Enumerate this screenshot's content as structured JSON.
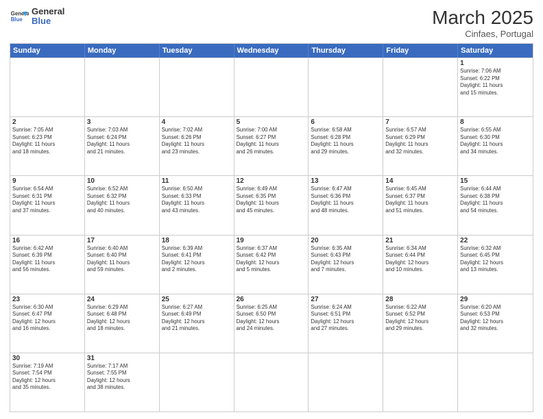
{
  "header": {
    "logo_general": "General",
    "logo_blue": "Blue",
    "month": "March 2025",
    "location": "Cinfaes, Portugal"
  },
  "days_of_week": [
    "Sunday",
    "Monday",
    "Tuesday",
    "Wednesday",
    "Thursday",
    "Friday",
    "Saturday"
  ],
  "weeks": [
    [
      {
        "day": "",
        "info": ""
      },
      {
        "day": "",
        "info": ""
      },
      {
        "day": "",
        "info": ""
      },
      {
        "day": "",
        "info": ""
      },
      {
        "day": "",
        "info": ""
      },
      {
        "day": "",
        "info": ""
      },
      {
        "day": "1",
        "info": "Sunrise: 7:06 AM\nSunset: 6:22 PM\nDaylight: 11 hours\nand 15 minutes."
      }
    ],
    [
      {
        "day": "2",
        "info": "Sunrise: 7:05 AM\nSunset: 6:23 PM\nDaylight: 11 hours\nand 18 minutes."
      },
      {
        "day": "3",
        "info": "Sunrise: 7:03 AM\nSunset: 6:24 PM\nDaylight: 11 hours\nand 21 minutes."
      },
      {
        "day": "4",
        "info": "Sunrise: 7:02 AM\nSunset: 6:26 PM\nDaylight: 11 hours\nand 23 minutes."
      },
      {
        "day": "5",
        "info": "Sunrise: 7:00 AM\nSunset: 6:27 PM\nDaylight: 11 hours\nand 26 minutes."
      },
      {
        "day": "6",
        "info": "Sunrise: 6:58 AM\nSunset: 6:28 PM\nDaylight: 11 hours\nand 29 minutes."
      },
      {
        "day": "7",
        "info": "Sunrise: 6:57 AM\nSunset: 6:29 PM\nDaylight: 11 hours\nand 32 minutes."
      },
      {
        "day": "8",
        "info": "Sunrise: 6:55 AM\nSunset: 6:30 PM\nDaylight: 11 hours\nand 34 minutes."
      }
    ],
    [
      {
        "day": "9",
        "info": "Sunrise: 6:54 AM\nSunset: 6:31 PM\nDaylight: 11 hours\nand 37 minutes."
      },
      {
        "day": "10",
        "info": "Sunrise: 6:52 AM\nSunset: 6:32 PM\nDaylight: 11 hours\nand 40 minutes."
      },
      {
        "day": "11",
        "info": "Sunrise: 6:50 AM\nSunset: 6:33 PM\nDaylight: 11 hours\nand 43 minutes."
      },
      {
        "day": "12",
        "info": "Sunrise: 6:49 AM\nSunset: 6:35 PM\nDaylight: 11 hours\nand 45 minutes."
      },
      {
        "day": "13",
        "info": "Sunrise: 6:47 AM\nSunset: 6:36 PM\nDaylight: 11 hours\nand 48 minutes."
      },
      {
        "day": "14",
        "info": "Sunrise: 6:45 AM\nSunset: 6:37 PM\nDaylight: 11 hours\nand 51 minutes."
      },
      {
        "day": "15",
        "info": "Sunrise: 6:44 AM\nSunset: 6:38 PM\nDaylight: 11 hours\nand 54 minutes."
      }
    ],
    [
      {
        "day": "16",
        "info": "Sunrise: 6:42 AM\nSunset: 6:39 PM\nDaylight: 11 hours\nand 56 minutes."
      },
      {
        "day": "17",
        "info": "Sunrise: 6:40 AM\nSunset: 6:40 PM\nDaylight: 11 hours\nand 59 minutes."
      },
      {
        "day": "18",
        "info": "Sunrise: 6:39 AM\nSunset: 6:41 PM\nDaylight: 12 hours\nand 2 minutes."
      },
      {
        "day": "19",
        "info": "Sunrise: 6:37 AM\nSunset: 6:42 PM\nDaylight: 12 hours\nand 5 minutes."
      },
      {
        "day": "20",
        "info": "Sunrise: 6:35 AM\nSunset: 6:43 PM\nDaylight: 12 hours\nand 7 minutes."
      },
      {
        "day": "21",
        "info": "Sunrise: 6:34 AM\nSunset: 6:44 PM\nDaylight: 12 hours\nand 10 minutes."
      },
      {
        "day": "22",
        "info": "Sunrise: 6:32 AM\nSunset: 6:45 PM\nDaylight: 12 hours\nand 13 minutes."
      }
    ],
    [
      {
        "day": "23",
        "info": "Sunrise: 6:30 AM\nSunset: 6:47 PM\nDaylight: 12 hours\nand 16 minutes."
      },
      {
        "day": "24",
        "info": "Sunrise: 6:29 AM\nSunset: 6:48 PM\nDaylight: 12 hours\nand 18 minutes."
      },
      {
        "day": "25",
        "info": "Sunrise: 6:27 AM\nSunset: 6:49 PM\nDaylight: 12 hours\nand 21 minutes."
      },
      {
        "day": "26",
        "info": "Sunrise: 6:25 AM\nSunset: 6:50 PM\nDaylight: 12 hours\nand 24 minutes."
      },
      {
        "day": "27",
        "info": "Sunrise: 6:24 AM\nSunset: 6:51 PM\nDaylight: 12 hours\nand 27 minutes."
      },
      {
        "day": "28",
        "info": "Sunrise: 6:22 AM\nSunset: 6:52 PM\nDaylight: 12 hours\nand 29 minutes."
      },
      {
        "day": "29",
        "info": "Sunrise: 6:20 AM\nSunset: 6:53 PM\nDaylight: 12 hours\nand 32 minutes."
      }
    ],
    [
      {
        "day": "30",
        "info": "Sunrise: 7:19 AM\nSunset: 7:54 PM\nDaylight: 12 hours\nand 35 minutes."
      },
      {
        "day": "31",
        "info": "Sunrise: 7:17 AM\nSunset: 7:55 PM\nDaylight: 12 hours\nand 38 minutes."
      },
      {
        "day": "",
        "info": ""
      },
      {
        "day": "",
        "info": ""
      },
      {
        "day": "",
        "info": ""
      },
      {
        "day": "",
        "info": ""
      },
      {
        "day": "",
        "info": ""
      }
    ]
  ]
}
